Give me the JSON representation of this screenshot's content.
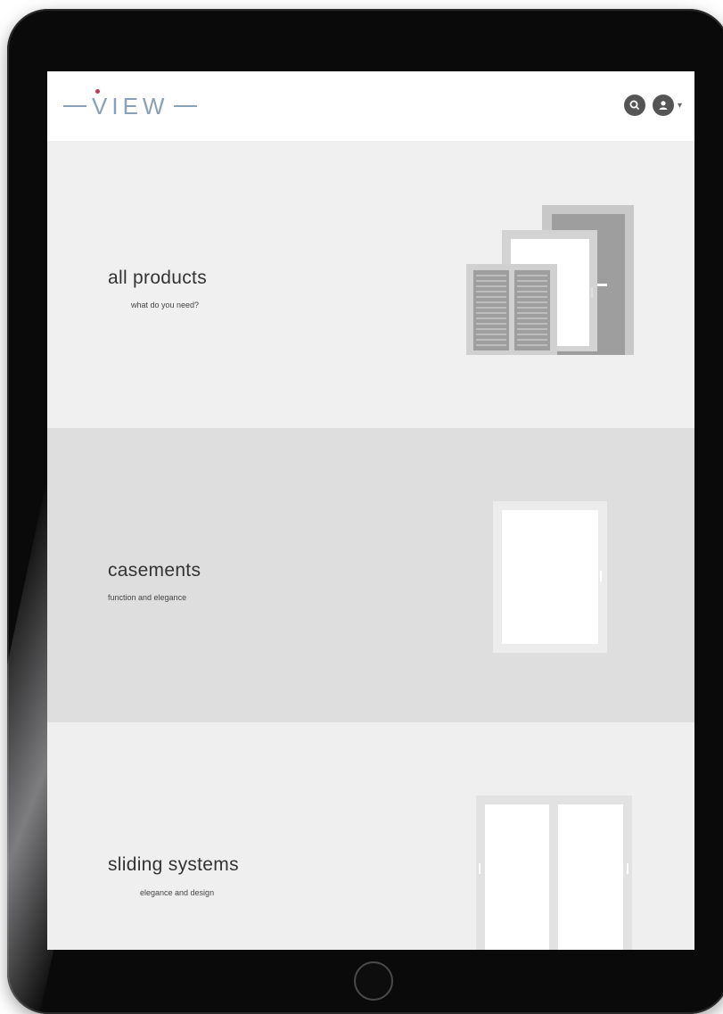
{
  "header": {
    "logo_text": "VIEW",
    "logo_accent_color": "#c0385a",
    "logo_color": "#8aa0b8",
    "icons": [
      "search-icon",
      "user-icon",
      "chevron-down-icon"
    ]
  },
  "sections": [
    {
      "title": "all products",
      "subtitle": "what do you need?",
      "illustration": "windows-doors-shutters"
    },
    {
      "title": "casements",
      "subtitle": "function and elegance",
      "illustration": "casement-window"
    },
    {
      "title": "sliding systems",
      "subtitle": "elegance and design",
      "illustration": "sliding-window"
    }
  ]
}
